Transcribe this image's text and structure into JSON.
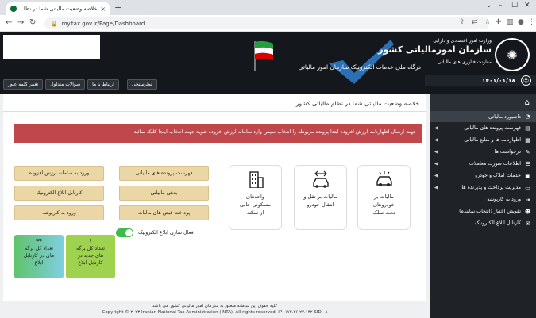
{
  "browser": {
    "tab_title": "خلاصه وضعیت مالیاتی شما در نظا...",
    "url": "my.tax.gov.ir/Page/Dashboard"
  },
  "header": {
    "portal_subtitle": "درگاه ملی خدمات الکترونیک سازمان امور مالیاتی",
    "ministry": "وزارت امور اقتصادی و دارایی",
    "org_name": "سازمان امورمالیاتی کشور",
    "org_dept": "معاونت فناوری های مالیاتی",
    "date": "۱۴۰۱/۰۱/۱۸",
    "buttons": [
      "تغییر کلمه عبور",
      "سوالات متداول",
      "ارتباط با ما"
    ],
    "survey_label": "نظرسنجی"
  },
  "sidebar": {
    "items": [
      {
        "label": "داشبورد مالیاتی",
        "icon": "dashboard-icon",
        "arrow": false
      },
      {
        "label": "فهرست پرونده های مالیاتی",
        "icon": "folder-icon",
        "arrow": true
      },
      {
        "label": "اظهارنامه ها و منابع مالیاتی",
        "icon": "document-icon",
        "arrow": true
      },
      {
        "label": "درخواست ها",
        "icon": "request-icon",
        "arrow": true
      },
      {
        "label": "اطلاعات صورت معاملات",
        "icon": "list-icon",
        "arrow": true
      },
      {
        "label": "خدمات املاک و خودرو",
        "icon": "car-icon",
        "arrow": true
      },
      {
        "label": "مدیریت پرداخت و پذیرنده ها",
        "icon": "card-icon",
        "arrow": true
      },
      {
        "label": "ورود به کارپوشه",
        "icon": "login-icon",
        "arrow": false
      },
      {
        "label": "تفویض اختیار (انتخاب نماینده)",
        "icon": "user-icon",
        "arrow": false
      },
      {
        "label": "کارتابل ابلاغ الکترونیک",
        "icon": "inbox-icon",
        "arrow": false
      }
    ]
  },
  "main": {
    "heading": "خلاصه وضعیت مالیاتی شما در نظام مالیاتی کشور",
    "alert": "جهت ارسال اظهارنامه ارزش افزوده ابتدا پرونده مربوطه را انتخاب سپس وارد سامانه ارزش افزوده شوید جهت انتخاب اینجا کلیک نمائید.",
    "cards": [
      {
        "line1": "مالیات بر",
        "line2": "خودروهای",
        "line3": "تحت تملک",
        "icon": "car-alert-icon"
      },
      {
        "line1": "مالیات بر نقل و",
        "line2": "انتقال خودرو",
        "line3": "",
        "icon": "car-transfer-icon"
      },
      {
        "line1": "واحدهای",
        "line2": "مسکونی خالی",
        "line3": "از سکنه",
        "icon": "building-icon"
      }
    ],
    "buttons_right": [
      "فهرست پرونده های مالیاتی",
      "بدهی مالیاتی",
      "پرداخت قبض های مالیات"
    ],
    "buttons_left": [
      "ورود به سامانه ارزش افزوده",
      "کارتابل ابلاغ الکترونیک",
      "ورود به کارپوشه"
    ],
    "toggle_label": "فعال سازی ابلاغ الکترونیک",
    "stats": [
      {
        "num": "۳۴",
        "line1": "تعداد کل برگه",
        "line2": "های در کارتابل",
        "line3": "ابلاغ"
      },
      {
        "num": "۱",
        "line1": "تعداد کل برگه",
        "line2": "های جدید در",
        "line3": "کارتابل ابلاغ"
      }
    ]
  },
  "footer": {
    "line1": "کلیه حقوق این سامانه متعلق به سازمان امور مالیاتی کشور می باشد",
    "line2": "Copyright © ۲۰۲۳ Iranian National Tax Administration (INTA). All rights reserved. IP: ۱۷۲.۲۶.۲۲.۱۴۲ SID:۰۸"
  },
  "colors": {
    "alert": "#c0474b",
    "gold": "#ead7a5",
    "sidebar": "#1f2328",
    "toggle": "#3dbb4b"
  }
}
